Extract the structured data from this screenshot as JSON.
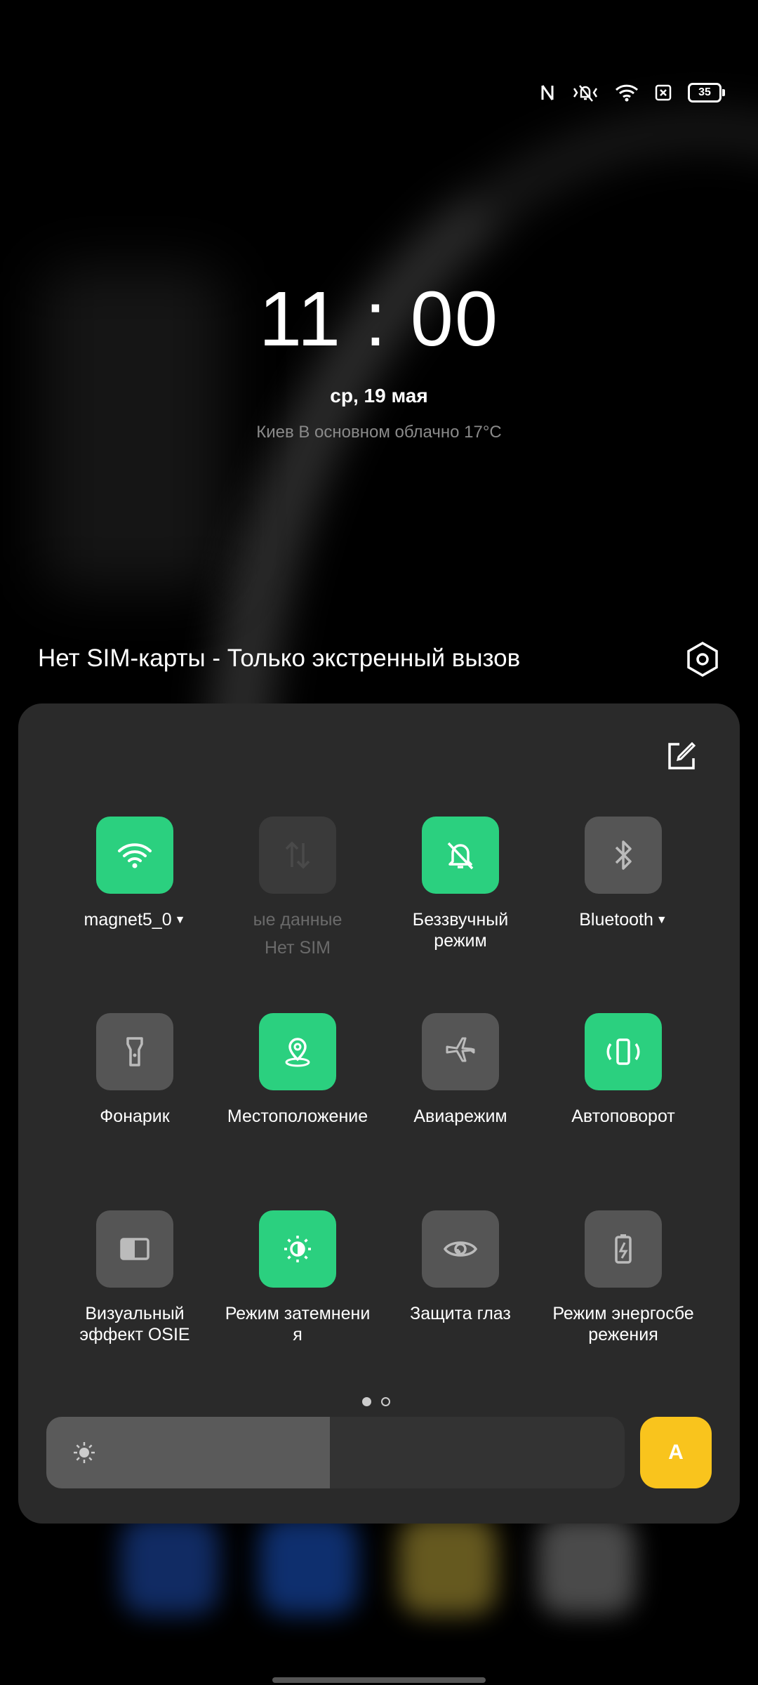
{
  "status_bar": {
    "battery": "35"
  },
  "lockscreen": {
    "time": "11 : 00",
    "date": "ср, 19 мая",
    "weather": "Киев В основном облачно 17°C",
    "sim_status": "Нет SIM-карты - Только экстренный вызов"
  },
  "quick_settings": {
    "tiles": [
      {
        "label": "magnet5_0",
        "state": "on",
        "icon": "wifi-icon",
        "dropdown": true
      },
      {
        "label": "ые данные",
        "sub": "Нет SIM",
        "state": "disabled",
        "icon": "mobile-data-icon"
      },
      {
        "label": "Беззвучный режим",
        "state": "on",
        "icon": "silent-bell-icon"
      },
      {
        "label": "Bluetooth",
        "state": "off",
        "icon": "bluetooth-icon",
        "dropdown": true
      },
      {
        "label": "Фонарик",
        "state": "off",
        "icon": "flashlight-icon"
      },
      {
        "label": "Местоположение",
        "state": "on",
        "icon": "location-icon"
      },
      {
        "label": "Авиарежим",
        "state": "off",
        "icon": "airplane-icon"
      },
      {
        "label": "Автоповорот",
        "state": "on",
        "icon": "auto-rotate-icon"
      },
      {
        "label1": "Визуальный",
        "label2": "эффект OSIE",
        "state": "off",
        "icon": "osie-icon"
      },
      {
        "label1": "Режим затемнени",
        "label2": "я",
        "state": "on",
        "icon": "dark-mode-icon"
      },
      {
        "label": "Защита глаз",
        "state": "off",
        "icon": "eye-protection-icon"
      },
      {
        "label1": "Режим энергосбе",
        "label2": "режения",
        "state": "off",
        "icon": "battery-saver-icon"
      }
    ],
    "page_indicator": {
      "current": 1,
      "total": 2
    },
    "brightness": {
      "level": 0.49,
      "auto_label": "A"
    }
  },
  "colors": {
    "accent_green": "#2bd07f",
    "auto_yellow": "#f9c41d",
    "panel": "#2a2a2a"
  }
}
